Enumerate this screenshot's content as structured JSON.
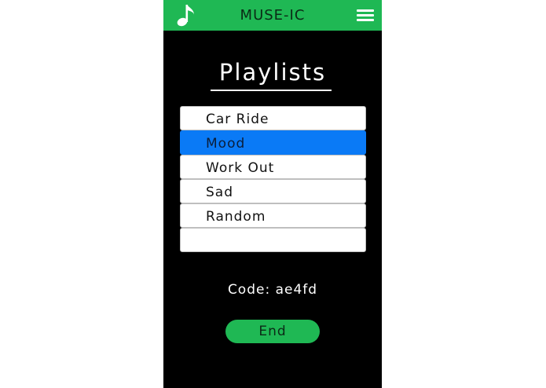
{
  "header": {
    "app_icon": "music-note-icon",
    "title": "MUSE-IC",
    "menu_icon": "hamburger-menu-icon",
    "color": "#1fb854"
  },
  "main": {
    "heading": "Playlists",
    "playlists": [
      {
        "label": "Car Ride",
        "selected": false
      },
      {
        "label": "Mood",
        "selected": true
      },
      {
        "label": "Work Out",
        "selected": false
      },
      {
        "label": "Sad",
        "selected": false
      },
      {
        "label": "Random",
        "selected": false
      },
      {
        "label": "",
        "selected": false
      }
    ],
    "selected_color": "#0a7af6",
    "code_label": "Code: ae4fd",
    "end_button_label": "End"
  }
}
